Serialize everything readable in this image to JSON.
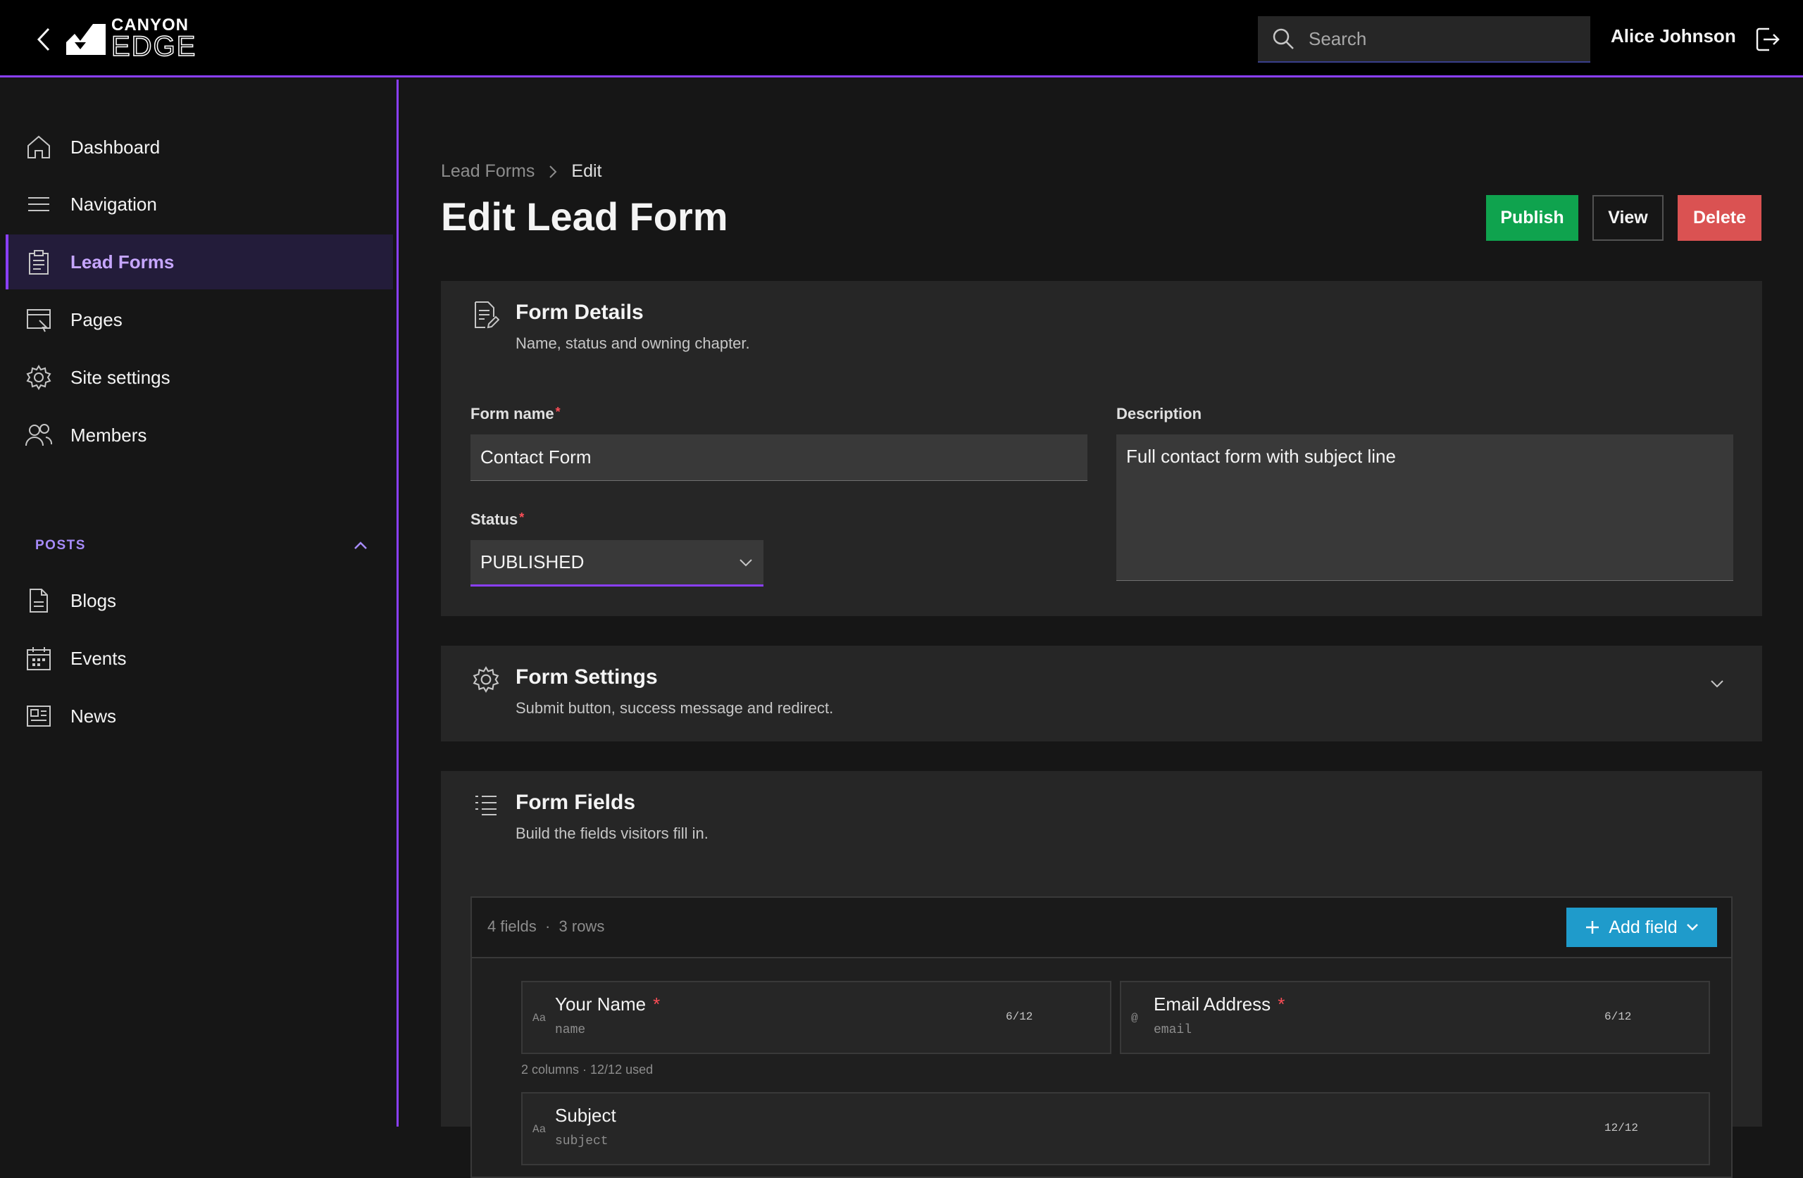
{
  "header": {
    "logo_top": "CANYON",
    "logo_bottom": "EDGE",
    "search_placeholder": "Search",
    "user_name": "Alice Johnson"
  },
  "sidebar": {
    "items": [
      {
        "label": "Dashboard",
        "icon": "home-icon"
      },
      {
        "label": "Navigation",
        "icon": "menu-icon"
      },
      {
        "label": "Lead Forms",
        "icon": "clipboard-icon",
        "active": true
      },
      {
        "label": "Pages",
        "icon": "browser-icon"
      },
      {
        "label": "Site settings",
        "icon": "gear-icon"
      },
      {
        "label": "Members",
        "icon": "users-icon"
      }
    ],
    "section_label": "POSTS",
    "section_items": [
      {
        "label": "Blogs",
        "icon": "document-icon"
      },
      {
        "label": "Events",
        "icon": "calendar-icon"
      },
      {
        "label": "News",
        "icon": "newspaper-icon"
      }
    ]
  },
  "breadcrumb": {
    "parent": "Lead Forms",
    "current": "Edit"
  },
  "page_title": "Edit Lead Form",
  "actions": {
    "publish": "Publish",
    "view": "View",
    "delete": "Delete"
  },
  "form_details": {
    "title": "Form Details",
    "subtitle": "Name, status and owning chapter.",
    "form_name_label": "Form name",
    "form_name_value": "Contact Form",
    "status_label": "Status",
    "status_value": "PUBLISHED",
    "description_label": "Description",
    "description_value": "Full contact form with subject line",
    "required_mark": "*"
  },
  "form_settings": {
    "title": "Form Settings",
    "subtitle": "Submit button, success message and redirect."
  },
  "form_fields": {
    "title": "Form Fields",
    "subtitle": "Build the fields visitors fill in.",
    "count_fields": "4 fields",
    "separator": "·",
    "count_rows": "3 rows",
    "add_field": "Add field",
    "fields": [
      {
        "type_glyph": "Aa",
        "label": "Your Name",
        "key": "name",
        "span": "6/12"
      },
      {
        "type_glyph": "@",
        "label": "Email Address",
        "key": "email",
        "span": "6/12"
      },
      {
        "type_glyph": "Aa",
        "label": "Subject",
        "key": "subject",
        "span": "12/12"
      }
    ],
    "row_meta": "2 columns · 12/12 used"
  },
  "colors": {
    "accent": "#8a3ffc",
    "publish": "#0fa34e",
    "delete": "#da5252",
    "add_field": "#1f9bcb"
  }
}
